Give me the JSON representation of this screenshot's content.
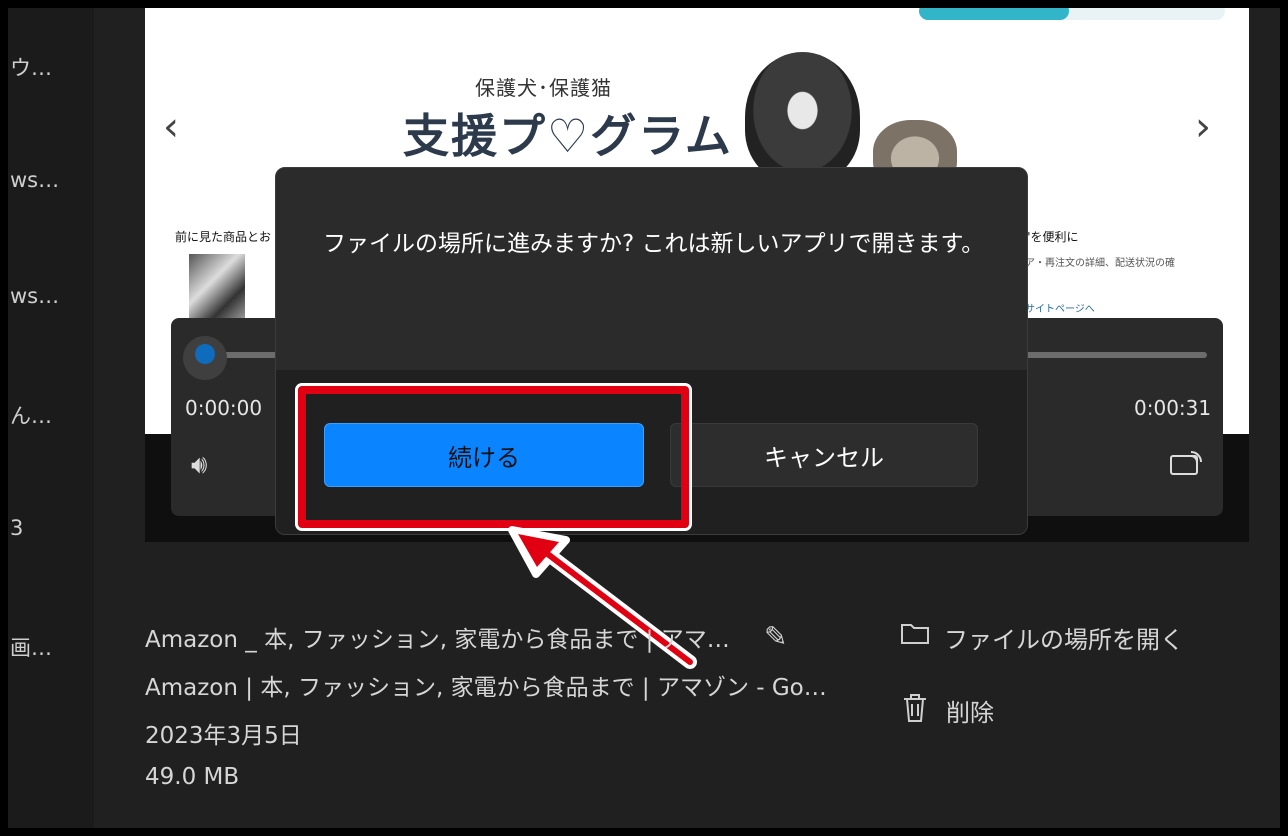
{
  "sidebar": {
    "items": [
      "ウ…",
      "ws…",
      "ws…",
      "ん…",
      "3",
      "画…"
    ]
  },
  "webpage": {
    "banner_sub": "保護犬･保護猫",
    "banner_title": "支援プ♡グラム",
    "prev_arrow": "‹",
    "next_arrow": "›",
    "caption_left": "前に見た商品とお",
    "caption_right": "る\"を便利に",
    "line_right": "ア・再注文の詳細、配送状況の確",
    "link_right": "サイトページへ"
  },
  "player": {
    "current_time": "0:00:00",
    "total_time": "0:00:31",
    "progress": 0
  },
  "dialog": {
    "message": "ファイルの場所に進みますか? これは新しいアプリで開きます。",
    "continue_label": "続ける",
    "cancel_label": "キャンセル"
  },
  "details": {
    "title": "Amazon _ 本, ファッション, 家電から食品まで | アマ…",
    "page_title": "Amazon | 本, ファッション, 家電から食品まで | アマゾン - Go…",
    "date": "2023年3月5日",
    "size": "49.0 MB"
  },
  "actions": {
    "open_location": "ファイルの場所を開く",
    "delete": "削除"
  },
  "icons": {
    "edit": "pencil-icon",
    "folder": "folder-icon",
    "trash": "trash-icon",
    "volume": "volume-icon",
    "cast": "cast-icon"
  },
  "colors": {
    "accent": "#0a84ff",
    "highlight": "#e10012"
  }
}
